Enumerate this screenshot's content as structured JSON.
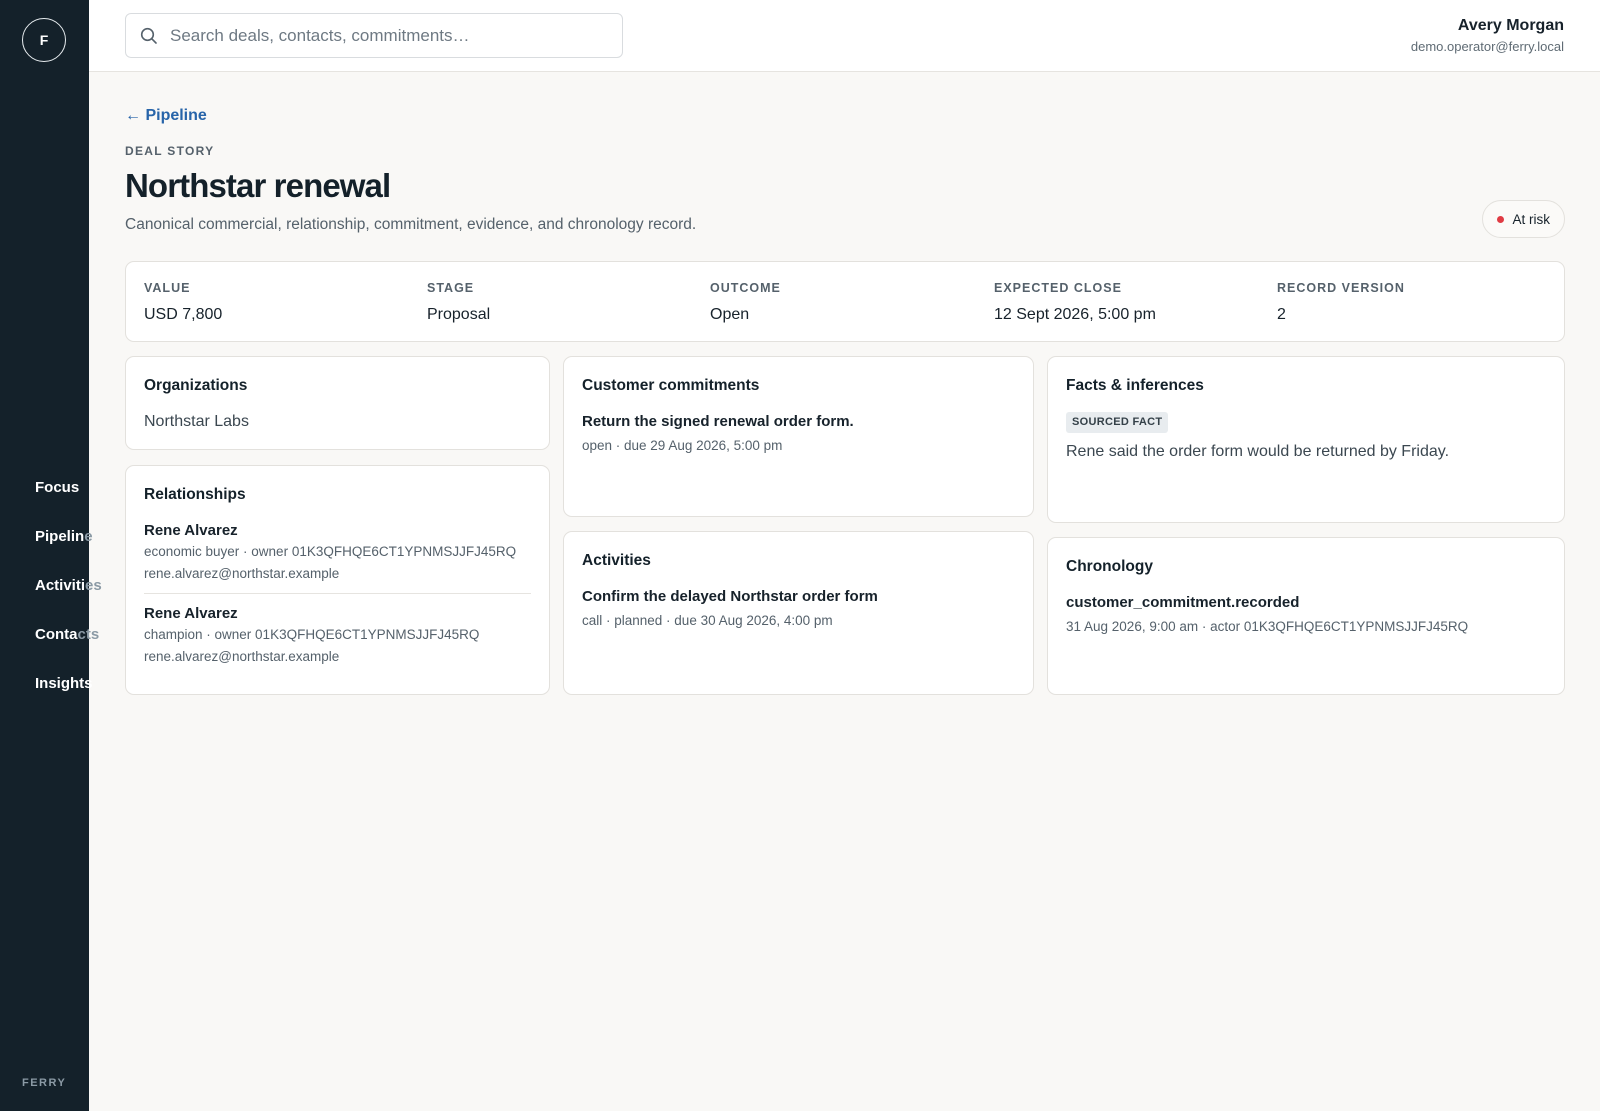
{
  "sidebar": {
    "logo_letter": "F",
    "items": [
      {
        "visible": "Focus",
        "overflow": ""
      },
      {
        "visible": "Pipelin",
        "overflow": "e"
      },
      {
        "visible": "Activiti",
        "overflow": "es"
      },
      {
        "visible": "Conta",
        "overflow": "cts"
      },
      {
        "visible": "Insights",
        "overflow": ""
      }
    ],
    "brand": "FERRY"
  },
  "search": {
    "placeholder": "Search deals, contacts, commitments…",
    "value": ""
  },
  "user": {
    "name": "Avery Morgan",
    "email": "demo.operator@ferry.local"
  },
  "breadcrumb": {
    "back_label": "← Pipeline"
  },
  "header": {
    "eyebrow": "DEAL STORY",
    "title": "Northstar renewal",
    "subtitle": "Canonical commercial, relationship, commitment, evidence, and chronology record.",
    "status": "At risk",
    "status_color": "#e03b43"
  },
  "metrics": [
    {
      "label": "VALUE",
      "value": "USD 7,800"
    },
    {
      "label": "STAGE",
      "value": "Proposal"
    },
    {
      "label": "OUTCOME",
      "value": "Open"
    },
    {
      "label": "EXPECTED CLOSE",
      "value": "12 Sept 2026, 5:00 pm"
    },
    {
      "label": "RECORD VERSION",
      "value": "2"
    }
  ],
  "organizations": {
    "title": "Organizations",
    "items": [
      "Northstar Labs"
    ]
  },
  "relationships": {
    "title": "Relationships",
    "items": [
      {
        "name": "Rene Alvarez",
        "meta": "economic buyer · owner 01K3QFHQE6CT1YPNMSJJFJ45RQ",
        "email": "rene.alvarez@northstar.example"
      },
      {
        "name": "Rene Alvarez",
        "meta": "champion · owner 01K3QFHQE6CT1YPNMSJJFJ45RQ",
        "email": "rene.alvarez@northstar.example"
      }
    ]
  },
  "commitments": {
    "title": "Customer commitments",
    "items": [
      {
        "title": "Return the signed renewal order form.",
        "meta": "open · due 29 Aug 2026, 5:00 pm"
      }
    ]
  },
  "activities": {
    "title": "Activities",
    "items": [
      {
        "title": "Confirm the delayed Northstar order form",
        "meta": "call · planned · due 30 Aug 2026, 4:00 pm"
      }
    ]
  },
  "facts": {
    "title": "Facts & inferences",
    "items": [
      {
        "tag": "SOURCED FACT",
        "text": "Rene said the order form would be returned by Friday."
      }
    ]
  },
  "chronology": {
    "title": "Chronology",
    "items": [
      {
        "event": "customer_commitment.recorded",
        "meta": "31 Aug 2026, 9:00 am · actor 01K3QFHQE6CT1YPNMSJJFJ45RQ"
      }
    ]
  }
}
